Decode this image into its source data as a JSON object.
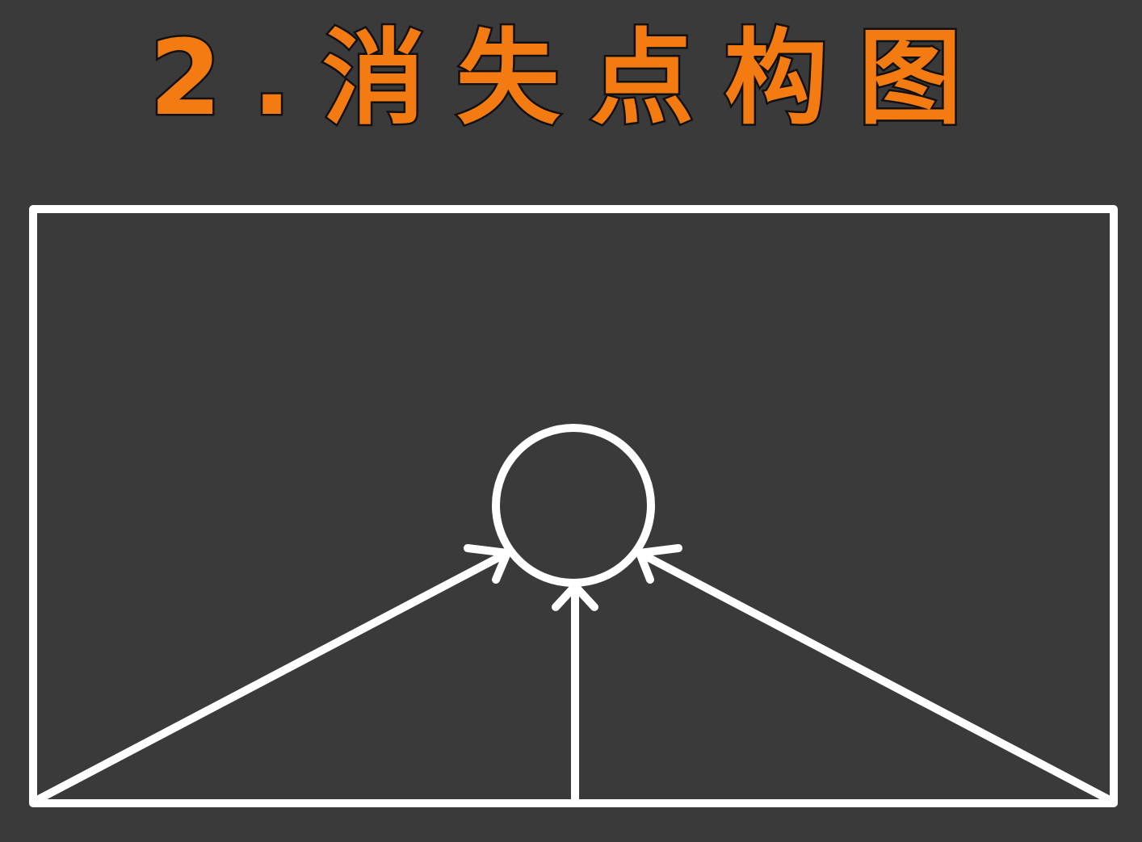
{
  "title": "2.消失点构图",
  "colors": {
    "background": "#3a3a3a",
    "title_fill": "#f47a12",
    "title_outline": "#111111",
    "lines": "#ffffff"
  }
}
